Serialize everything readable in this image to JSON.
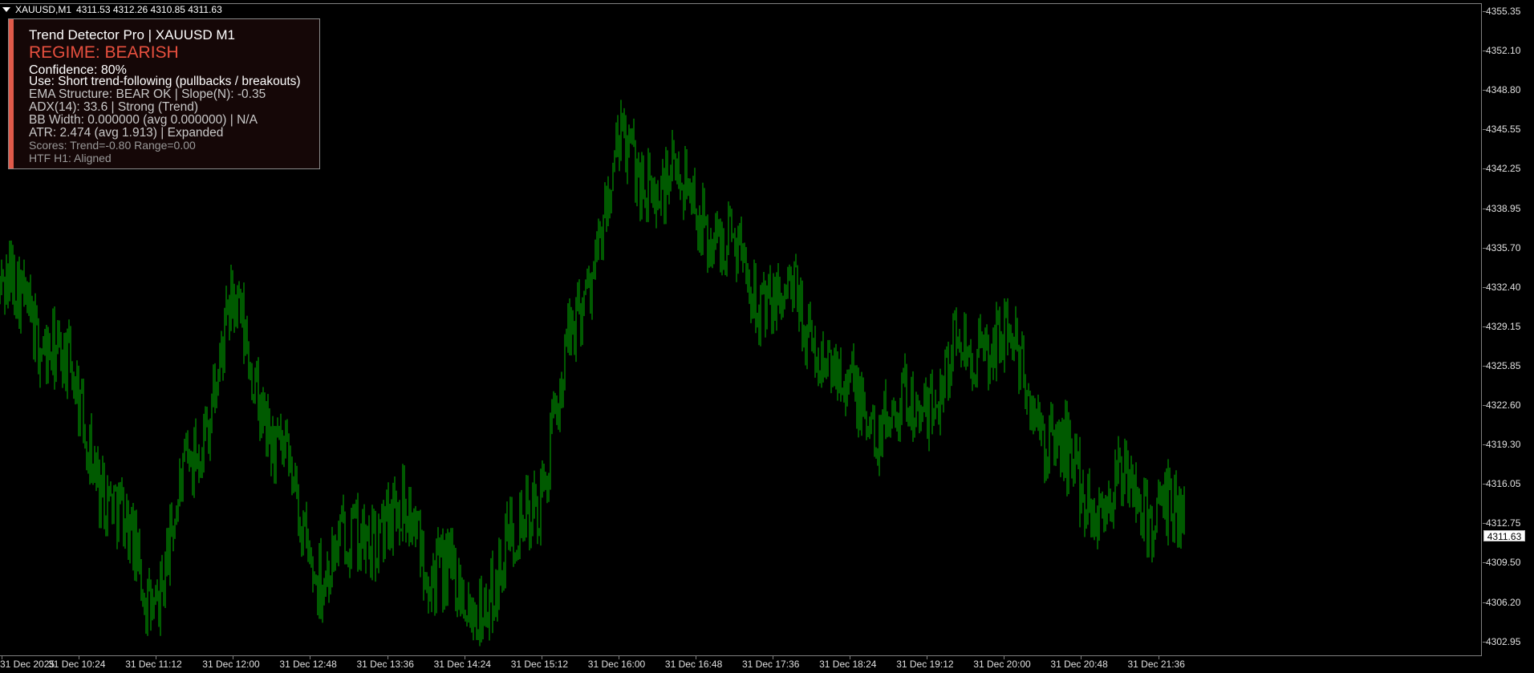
{
  "header": {
    "symbol": "XAUUSD,M1",
    "ohlc": "4311.53 4312.26 4310.85 4311.63"
  },
  "panel": {
    "title": "Trend Detector Pro  |  XAUUSD M1",
    "regime": "REGIME: BEARISH",
    "confidence": "Confidence: 80%",
    "use": "Use: Short trend-following (pullbacks / breakouts)",
    "ema": "EMA Structure: BEAR OK | Slope(N): -0.35",
    "adx": "ADX(14): 33.6 | Strong (Trend)",
    "bb": "BB Width: 0.000000 (avg 0.000000) | N/A",
    "atr": "ATR: 2.474 (avg 1.913) | Expanded",
    "scores": "Scores: Trend=-0.80  Range=0.00",
    "htf": "HTF H1: Aligned",
    "accent_color": "#e05a4a",
    "regime_color": "#e8503f"
  },
  "price_axis": {
    "labels": [
      "4355.35",
      "4352.10",
      "4348.80",
      "4345.55",
      "4342.25",
      "4338.95",
      "4335.70",
      "4332.40",
      "4329.15",
      "4325.85",
      "4322.60",
      "4319.30",
      "4316.05",
      "4312.75",
      "4309.50",
      "4306.20",
      "4302.95"
    ],
    "current_price": "4311.63"
  },
  "time_axis": {
    "labels": [
      "31 Dec 2025",
      "31 Dec 10:24",
      "31 Dec 11:12",
      "31 Dec 12:00",
      "31 Dec 12:48",
      "31 Dec 13:36",
      "31 Dec 14:24",
      "31 Dec 15:12",
      "31 Dec 16:00",
      "31 Dec 16:48",
      "31 Dec 17:36",
      "31 Dec 18:24",
      "31 Dec 19:12",
      "31 Dec 20:00",
      "31 Dec 20:48",
      "31 Dec 21:36"
    ]
  },
  "chart_data": {
    "type": "line",
    "bar_color": "#00b400",
    "ylim": [
      4302.95,
      4355.35
    ],
    "x": [
      "31 Dec 2025",
      "31 Dec 10:24",
      "31 Dec 11:12",
      "31 Dec 12:00",
      "31 Dec 12:48",
      "31 Dec 13:36",
      "31 Dec 14:24",
      "31 Dec 15:12",
      "31 Dec 16:00",
      "31 Dec 16:48",
      "31 Dec 17:36",
      "31 Dec 18:24",
      "31 Dec 19:12",
      "31 Dec 20:00",
      "31 Dec 20:48",
      "31 Dec 21:36"
    ],
    "series": [
      {
        "values": [
          4332.5,
          4322.0,
          4309.0,
          4328.0,
          4312.5,
          4313.0,
          4306.0,
          4318.0,
          4341.0,
          4342.5,
          4330.0,
          4324.5,
          4324.0,
          4327.0,
          4318.5,
          4310.5
        ]
      }
    ]
  }
}
